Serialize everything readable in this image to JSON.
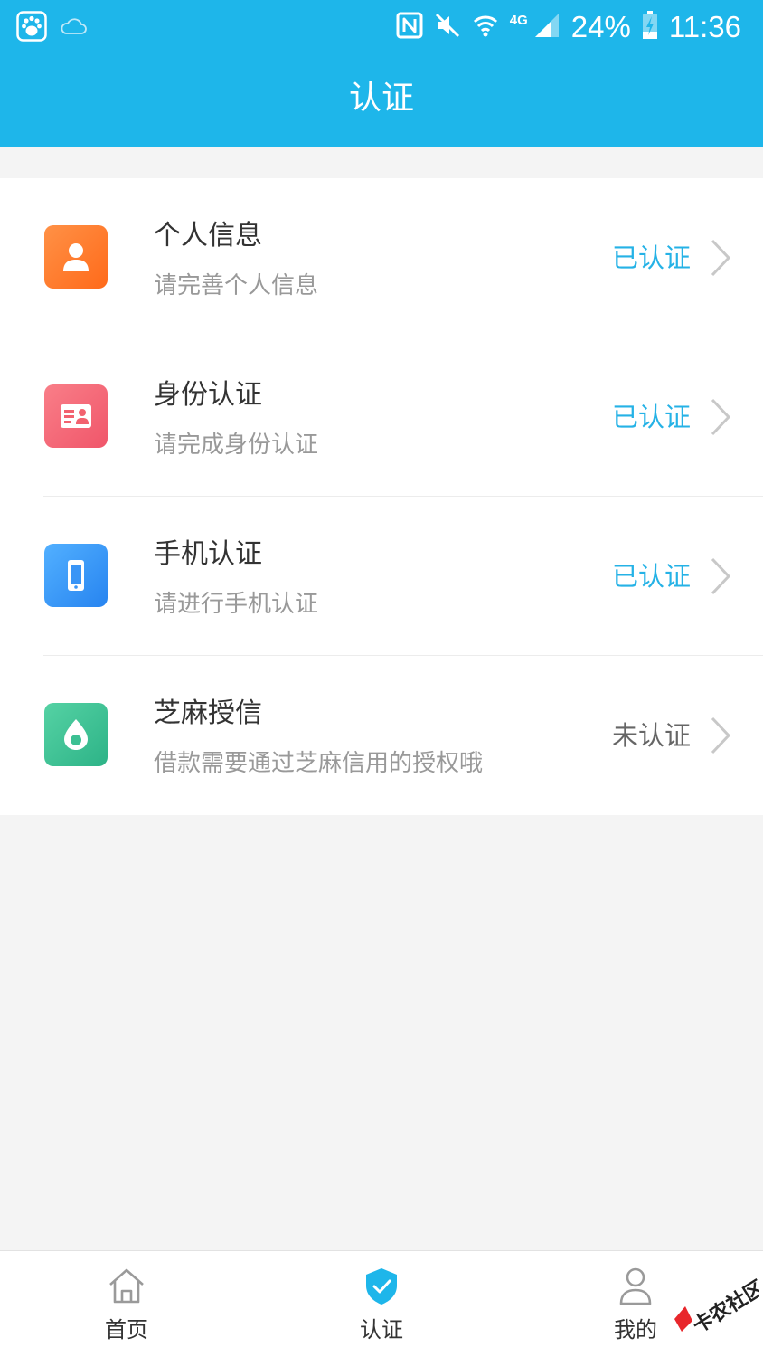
{
  "status_bar": {
    "battery": "24%",
    "time": "11:36",
    "network": "4G",
    "icons": [
      "baidu-app-icon",
      "cloud-icon",
      "nfc-icon",
      "mute-icon",
      "wifi-icon",
      "signal-icon",
      "battery-charging-icon"
    ]
  },
  "header": {
    "title": "认证"
  },
  "items": [
    {
      "title": "个人信息",
      "desc": "请完善个人信息",
      "status": "已认证",
      "icon": "person-icon",
      "color_from": "#ff8a3d",
      "color_to": "#ff6a1a"
    },
    {
      "title": "身份认证",
      "desc": "请完成身份认证",
      "status": "已认证",
      "icon": "id-card-icon",
      "color_from": "#f7727e",
      "color_to": "#f2566a"
    },
    {
      "title": "手机认证",
      "desc": "请进行手机认证",
      "status": "已认证",
      "icon": "phone-icon",
      "color_from": "#45a6ff",
      "color_to": "#2a86f2"
    },
    {
      "title": "芝麻授信",
      "desc": "借款需要通过芝麻信用的授权哦",
      "status": "未认证",
      "icon": "sesame-drop-icon",
      "color_from": "#4fcf9f",
      "color_to": "#2fb689"
    }
  ],
  "tabbar": {
    "tabs": [
      {
        "label": "首页",
        "icon": "home-icon"
      },
      {
        "label": "认证",
        "icon": "verify-shield-icon",
        "active": true
      },
      {
        "label": "我的",
        "icon": "profile-icon"
      }
    ]
  },
  "watermark": "卡农社区",
  "colors": {
    "primary": "#1eb6ea",
    "verified": "#25b2e6",
    "background": "#f4f4f4"
  }
}
